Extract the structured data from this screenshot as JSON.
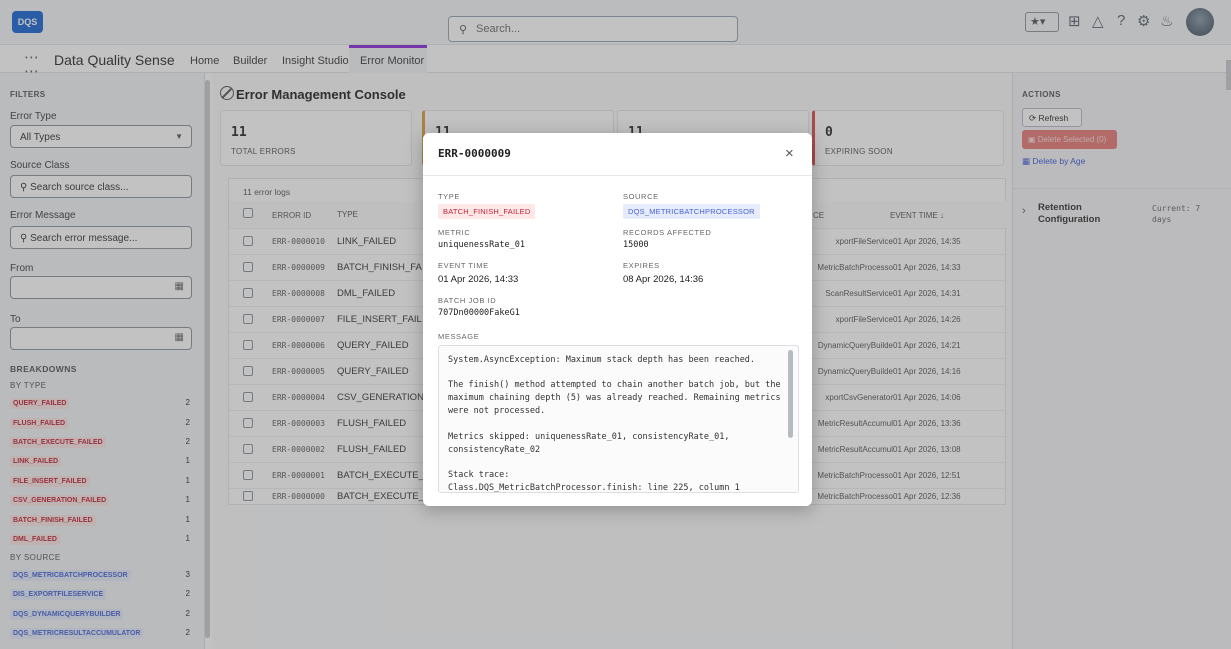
{
  "topbar": {
    "logo": "DQS",
    "search_placeholder": "Search...",
    "favorites": "★▾"
  },
  "nav": {
    "app_name": "Data Quality Sense",
    "tabs": [
      "Home",
      "Builder",
      "Insight Studio",
      "Error Monitor"
    ]
  },
  "filters": {
    "heading": "FILTERS",
    "error_type_label": "Error Type",
    "error_type_value": "All Types",
    "source_class_label": "Source Class",
    "source_class_placeholder": "Search source class...",
    "error_message_label": "Error Message",
    "error_message_placeholder": "Search error message...",
    "from_label": "From",
    "to_label": "To"
  },
  "breakdowns": {
    "heading": "BREAKDOWNS",
    "by_type_heading": "BY TYPE",
    "by_type": [
      {
        "label": "QUERY_FAILED",
        "count": "2"
      },
      {
        "label": "FLUSH_FAILED",
        "count": "2"
      },
      {
        "label": "BATCH_EXECUTE_FAILED",
        "count": "2"
      },
      {
        "label": "LINK_FAILED",
        "count": "1"
      },
      {
        "label": "FILE_INSERT_FAILED",
        "count": "1"
      },
      {
        "label": "CSV_GENERATION_FAILED",
        "count": "1"
      },
      {
        "label": "BATCH_FINISH_FAILED",
        "count": "1"
      },
      {
        "label": "DML_FAILED",
        "count": "1"
      }
    ],
    "by_source_heading": "BY SOURCE",
    "by_source": [
      {
        "label": "DQS_METRICBATCHPROCESSOR",
        "count": "3"
      },
      {
        "label": "DIS_EXPORTFILESERVICE",
        "count": "2"
      },
      {
        "label": "DQS_DYNAMICQUERYBUILDER",
        "count": "2"
      },
      {
        "label": "DQS_METRICRESULTACCUMULATOR",
        "count": "2"
      }
    ]
  },
  "console": {
    "title": "Error Management Console",
    "cards": [
      {
        "value": "11",
        "label": "TOTAL ERRORS"
      },
      {
        "value": "11",
        "label": ""
      },
      {
        "value": "11",
        "label": ""
      },
      {
        "value": "0",
        "label": "EXPIRING SOON"
      }
    ],
    "log_count": "11 error logs",
    "columns": {
      "error_id": "ERROR ID",
      "type": "TYPE",
      "source": "CE",
      "event_time": "EVENT TIME ↓"
    },
    "rows": [
      {
        "id": "ERR-0000010",
        "type": "LINK_FAILED",
        "source": "xportFileService",
        "time": "01 Apr 2026, 14:35"
      },
      {
        "id": "ERR-0000009",
        "type": "BATCH_FINISH_FA",
        "source": "MetricBatchProcesso",
        "time": "01 Apr 2026, 14:33"
      },
      {
        "id": "ERR-0000008",
        "type": "DML_FAILED",
        "source": "ScanResultService",
        "time": "01 Apr 2026, 14:31"
      },
      {
        "id": "ERR-0000007",
        "type": "FILE_INSERT_FAIL",
        "source": "xportFileService",
        "time": "01 Apr 2026, 14:26"
      },
      {
        "id": "ERR-0000006",
        "type": "QUERY_FAILED",
        "source": "DynamicQueryBuilde",
        "time": "01 Apr 2026, 14:21"
      },
      {
        "id": "ERR-0000005",
        "type": "QUERY_FAILED",
        "source": "DynamicQueryBuilde",
        "time": "01 Apr 2026, 14:16"
      },
      {
        "id": "ERR-0000004",
        "type": "CSV_GENERATION",
        "source": "xportCsvGenerator",
        "time": "01 Apr 2026, 14:06"
      },
      {
        "id": "ERR-0000003",
        "type": "FLUSH_FAILED",
        "source": "MetricResultAccumul",
        "time": "01 Apr 2026, 13:36"
      },
      {
        "id": "ERR-0000002",
        "type": "FLUSH_FAILED",
        "source": "MetricResultAccumul",
        "time": "01 Apr 2026, 13:08"
      },
      {
        "id": "ERR-0000001",
        "type": "BATCH_EXECUTE_",
        "source": "MetricBatchProcesso",
        "time": "01 Apr 2026, 12:51"
      },
      {
        "id": "ERR-0000000",
        "type": "BATCH_EXECUTE_",
        "source": "MetricBatchProcesso",
        "time": "01 Apr 2026, 12:36"
      }
    ]
  },
  "actions": {
    "heading": "ACTIONS",
    "refresh": "Refresh",
    "delete_selected": "Delete Selected (0)",
    "delete_by_age": "Delete by Age",
    "retention_title": "Retention Configuration",
    "retention_current": "Current: 7 days"
  },
  "modal": {
    "title": "ERR-0000009",
    "type_label": "TYPE",
    "type_value": "BATCH_FINISH_FAILED",
    "source_label": "SOURCE",
    "source_value": "DQS_METRICBATCHPROCESSOR",
    "metric_label": "METRIC",
    "metric_value": "uniquenessRate_01",
    "records_label": "RECORDS AFFECTED",
    "records_value": "15000",
    "event_time_label": "EVENT TIME",
    "event_time_value": "01 Apr 2026, 14:33",
    "expires_label": "EXPIRES",
    "expires_value": "08 Apr 2026, 14:36",
    "batch_label": "BATCH JOB ID",
    "batch_value": "707Dn00000FakeG1",
    "message_label": "MESSAGE",
    "message_lines": [
      "System.AsyncException: Maximum stack depth has been reached.",
      "",
      "The finish() method attempted to chain another batch job, but the",
      "maximum chaining depth (5) was already reached. Remaining metrics",
      "were not processed.",
      "",
      "Metrics skipped: uniquenessRate_01, consistencyRate_01,",
      "consistencyRate_02",
      "",
      "Stack trace:",
      "Class.DQS_MetricBatchProcessor.finish: line 225, column 1"
    ]
  },
  "colors": {
    "accent": "#8a2bd6",
    "brand": "#1b66d6",
    "danger": "#e26f6f"
  }
}
